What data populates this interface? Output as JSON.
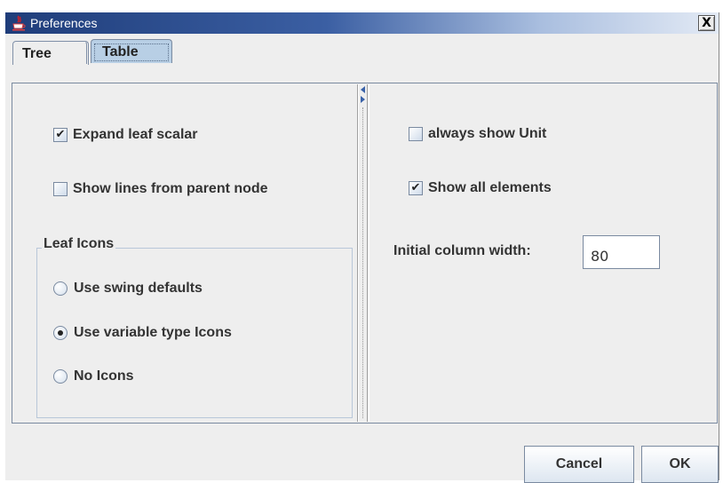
{
  "window": {
    "title": "Preferences",
    "close_glyph": "X"
  },
  "tabs": [
    {
      "label": "Tree",
      "selected": false
    },
    {
      "label": "Table",
      "selected": true
    }
  ],
  "left_pane": {
    "expand_leaf_scalar": {
      "label": "Expand leaf scalar",
      "checked": true
    },
    "show_lines": {
      "label": "Show lines from parent node",
      "checked": false
    },
    "leaf_icons_group": {
      "title": "Leaf Icons",
      "options": [
        {
          "label": "Use swing defaults",
          "selected": false
        },
        {
          "label": "Use variable type Icons",
          "selected": true
        },
        {
          "label": "No Icons",
          "selected": false
        }
      ]
    }
  },
  "right_pane": {
    "always_show_unit": {
      "label": "always show Unit",
      "checked": false
    },
    "show_all_elements": {
      "label": "Show all elements",
      "checked": true
    },
    "column_width_label": "Initial column width:",
    "column_width_value": "80"
  },
  "buttons": {
    "cancel": "Cancel",
    "ok": "OK"
  },
  "check_glyph": "✔",
  "colors": {
    "selected_tab": "#b8cfe5",
    "titlebar_dark": "#1f3d7a",
    "divider_arrow": "#3a62a8"
  }
}
